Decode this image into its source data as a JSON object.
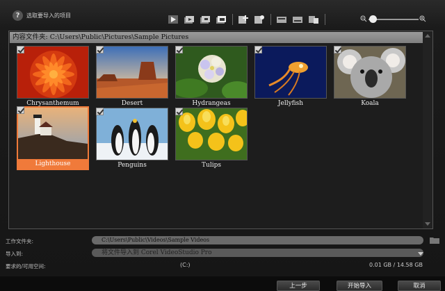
{
  "header": {
    "title": "选取要导入的项目",
    "help": "?"
  },
  "toolbar": {
    "icons": [
      "play-icon",
      "import-icon-1",
      "import-icon-2",
      "import-icon-3",
      "add-icon",
      "add-settings-icon",
      "view-icon-1",
      "view-icon-2",
      "view-icon-3"
    ],
    "zoom_minus": "−",
    "zoom_plus": "+",
    "zoom_level": 0.02
  },
  "panel": {
    "path": "内容文件夹: C:\\Users\\Public\\Pictures\\Sample Pictures",
    "items": [
      {
        "label": "Chrysanthemum",
        "checked": true,
        "selected": false
      },
      {
        "label": "Desert",
        "checked": true,
        "selected": false
      },
      {
        "label": "Hydrangeas",
        "checked": true,
        "selected": false
      },
      {
        "label": "Jellyfish",
        "checked": true,
        "selected": false
      },
      {
        "label": "Koala",
        "checked": true,
        "selected": false
      },
      {
        "label": "Lighthouse",
        "checked": true,
        "selected": true
      },
      {
        "label": "Penguins",
        "checked": true,
        "selected": false
      },
      {
        "label": "Tulips",
        "checked": true,
        "selected": false
      }
    ]
  },
  "form": {
    "work_folder_label": "工作文件夹:",
    "work_folder_value": "C:\\Users\\Public\\Videos\\Sample Videos",
    "import_to_label": "导入到:",
    "import_to_value": "将文件导入到 Corel VideoStudio Pro",
    "space_label": "要求的/可用空间:",
    "drive": "(C:)",
    "space": "0.01 GB / 14.58 GB"
  },
  "buttons": {
    "prev": "上一步",
    "start": "开始导入",
    "cancel": "取消"
  },
  "colors": {
    "selected": "#f07a3a",
    "path_bar": "#8c8c8c",
    "background": "#161616"
  }
}
